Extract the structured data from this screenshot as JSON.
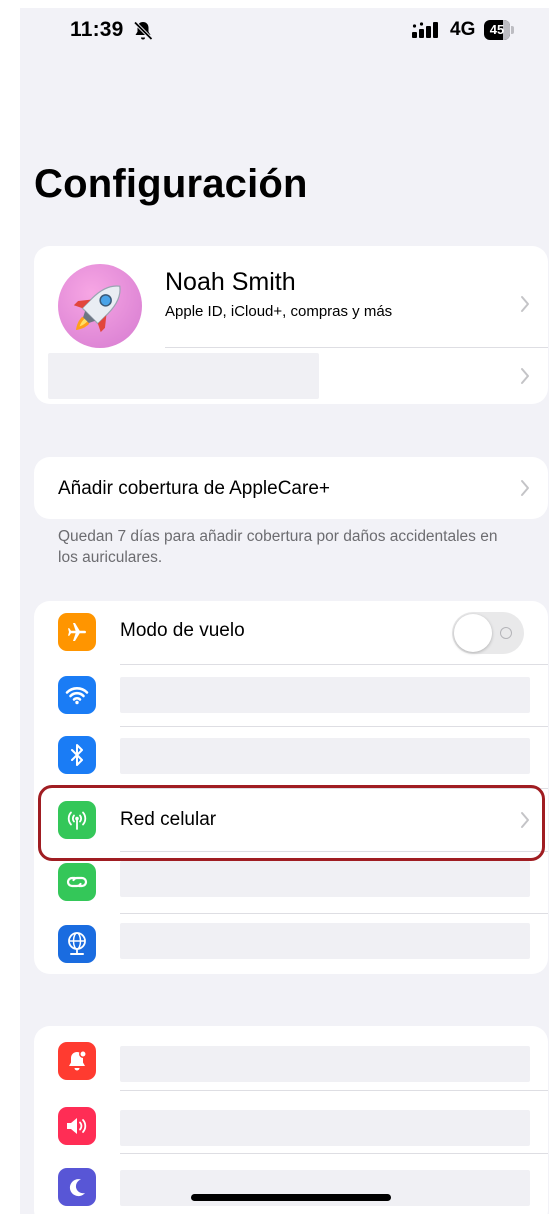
{
  "status_bar": {
    "time": "11:39",
    "network": "4G",
    "battery": "45"
  },
  "page": {
    "title": "Configuración"
  },
  "profile": {
    "name": "Noah Smith",
    "subtitle": "Apple ID, iCloud+, compras y más",
    "avatar_emoji": "🚀"
  },
  "applecare": {
    "label": "Añadir cobertura de AppleCare+",
    "footnote": "Quedan 7 días para añadir cobertura por daños accidentales en los auriculares."
  },
  "connectivity": {
    "airplane_label": "Modo de vuelo",
    "airplane_on": false,
    "cellular_label": "Red celular"
  },
  "colors": {
    "background": "#f2f2f7",
    "airplane": "#ff9500",
    "wifi": "#1a7cf5",
    "bluetooth": "#1a7cf5",
    "cellular": "#34c759",
    "hotspot": "#34c759",
    "vpn": "#1a6ce0",
    "notifications": "#ff3b30",
    "sounds": "#ff2d55",
    "focus": "#5856d6",
    "highlight": "#a01d22"
  }
}
